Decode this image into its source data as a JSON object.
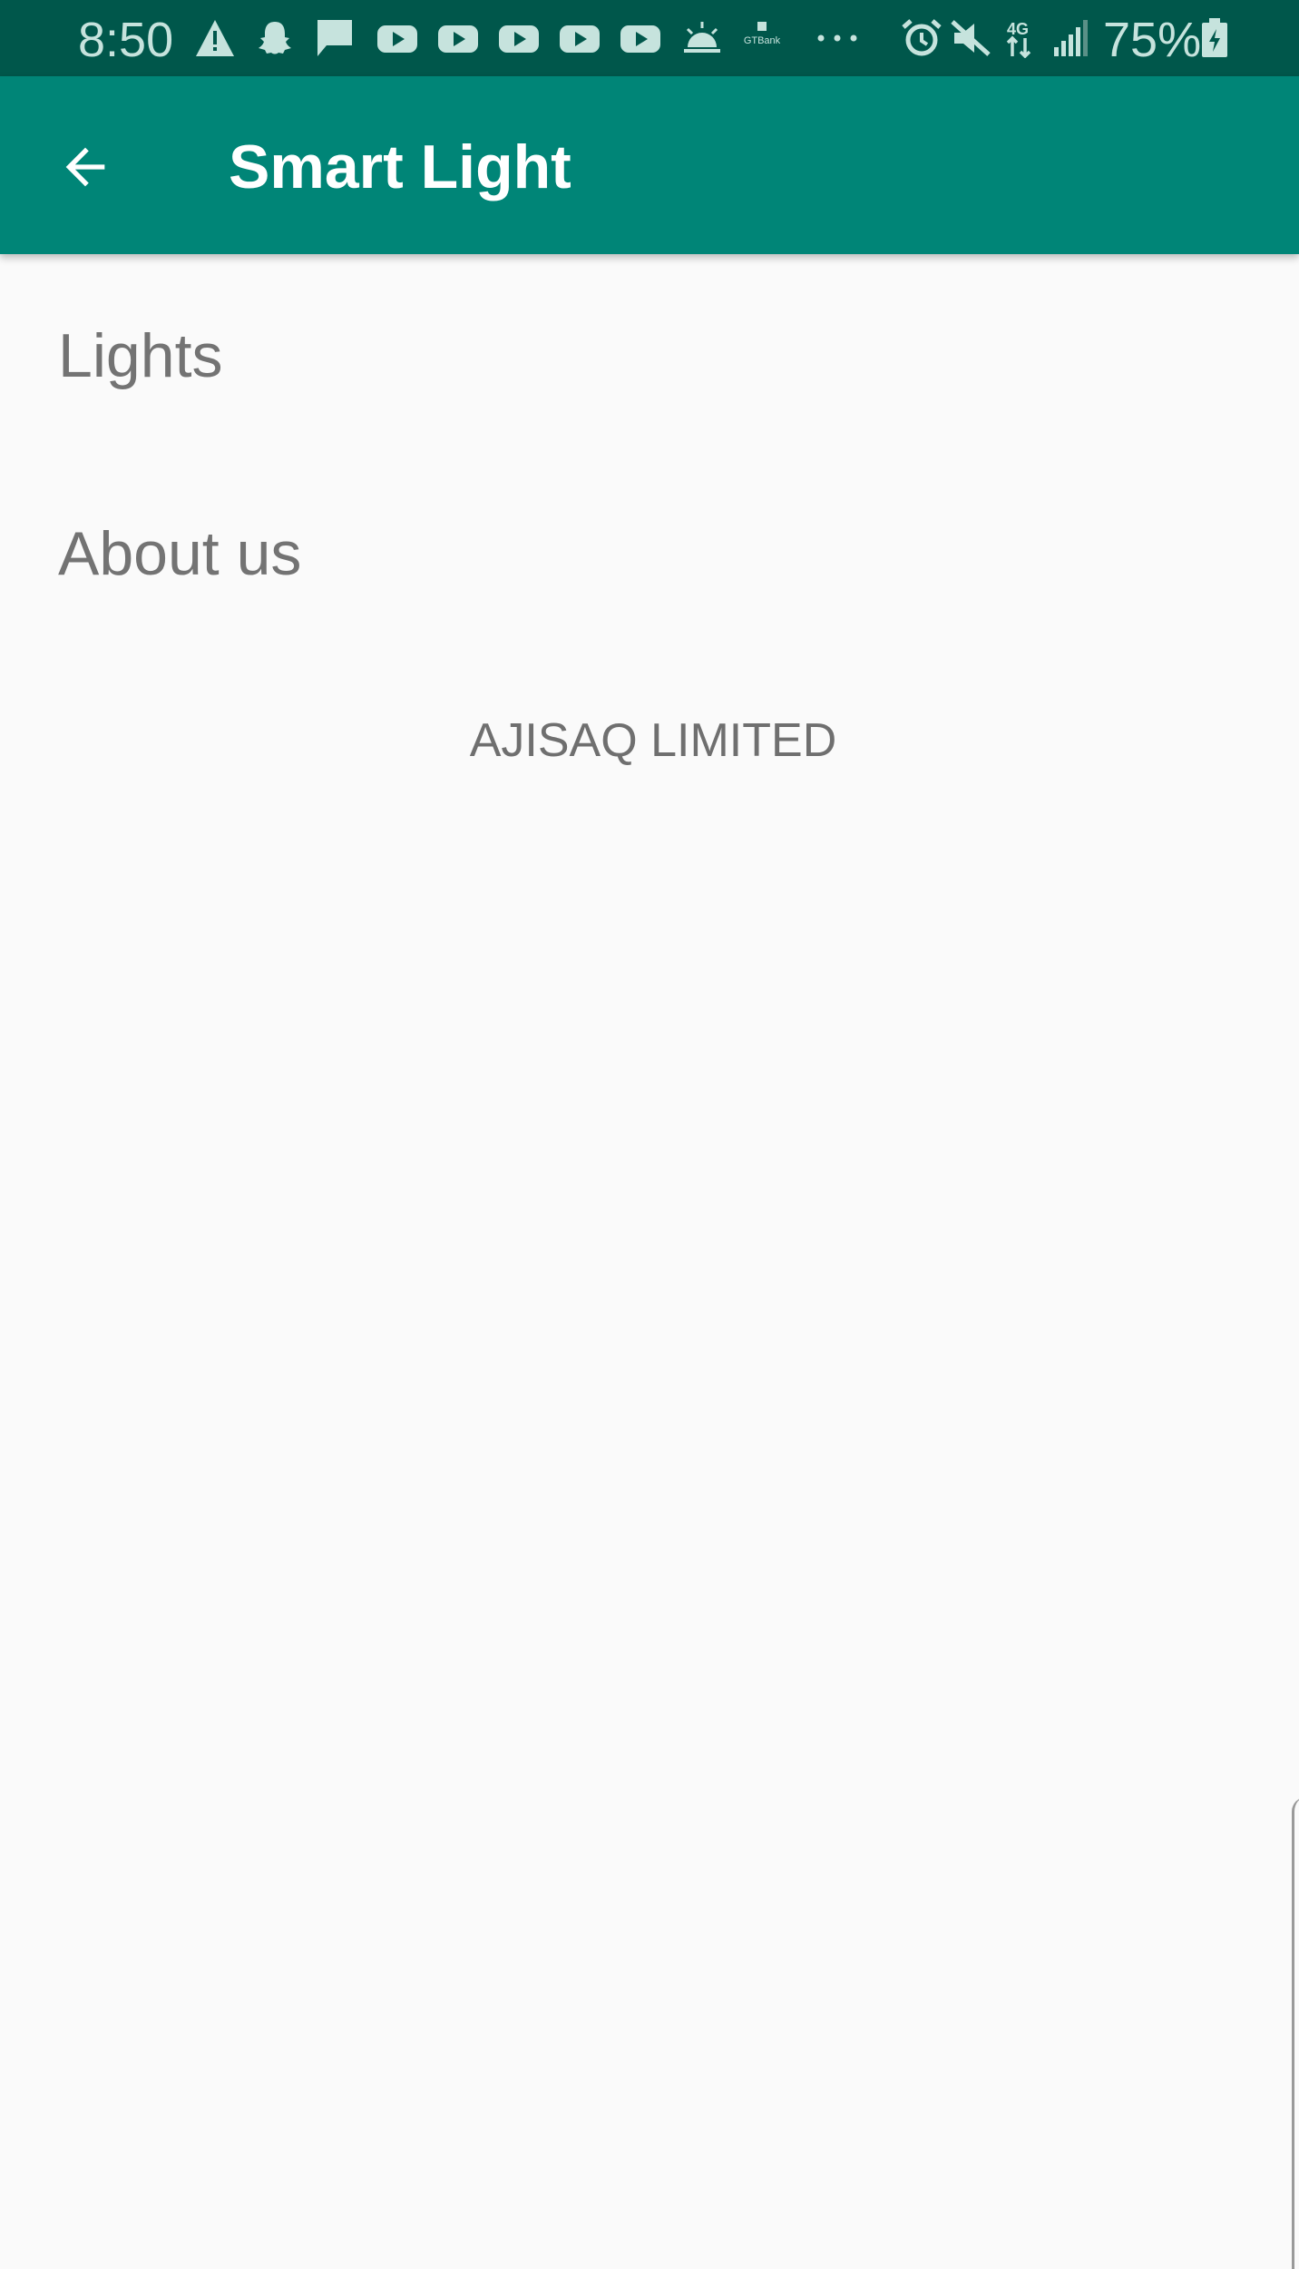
{
  "status_bar": {
    "time": "8:50",
    "battery_percent": "75%",
    "bank_label": "GTBank",
    "icons": [
      "warning-icon",
      "snapchat-icon",
      "message-icon",
      "youtube-icon",
      "youtube-icon",
      "youtube-icon",
      "youtube-icon",
      "youtube-icon",
      "weather-sunrise-icon",
      "gtbank-icon",
      "more-dots-icon",
      "alarm-icon",
      "mute-icon",
      "4g-data-icon",
      "signal-icon",
      "battery-charging-icon"
    ],
    "background_color": "#00574b"
  },
  "app_bar": {
    "title": "Smart Light",
    "back_icon": "arrow-back-icon",
    "background_color": "#008577"
  },
  "menu": {
    "items": [
      {
        "label": "Lights"
      },
      {
        "label": "About us"
      }
    ]
  },
  "footer": {
    "company": "AJISAQ LIMITED"
  }
}
